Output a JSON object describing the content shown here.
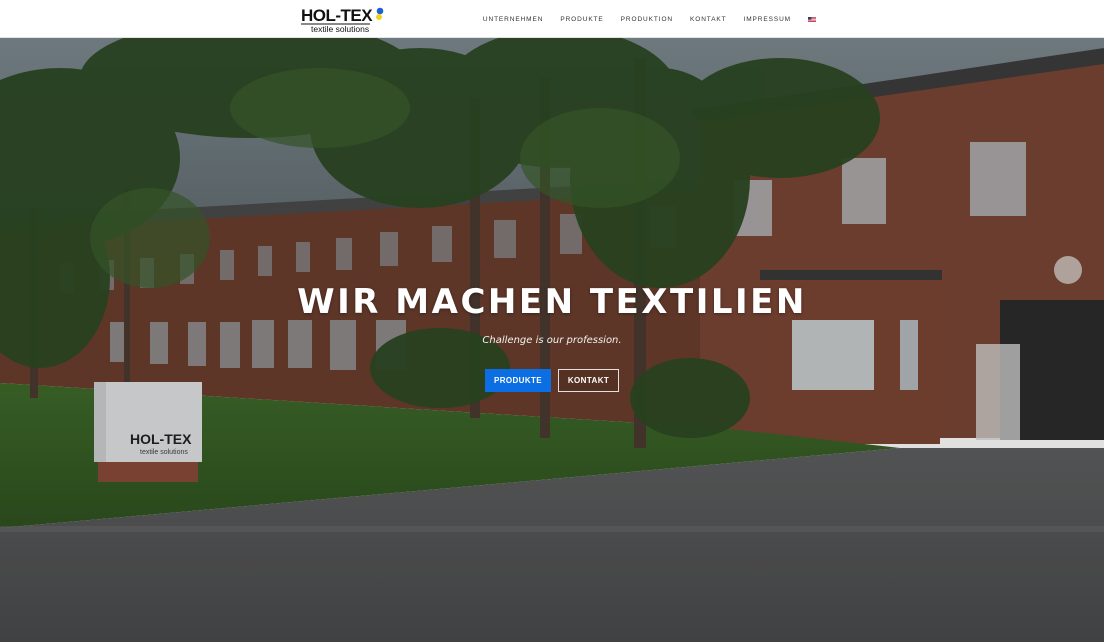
{
  "brand": {
    "logo_text": "HOL-TEX",
    "logo_subtext": "textile solutions"
  },
  "nav": {
    "items": [
      "UNTERNEHMEN",
      "PRODUKTE",
      "PRODUKTION",
      "KONTAKT",
      "IMPRESSUM"
    ],
    "language_icon": "us-flag-icon"
  },
  "hero": {
    "title": "WIR MACHEN TEXTILIEN",
    "subtitle": "Challenge is our profession.",
    "primary_button": "PRODUKTE",
    "secondary_button": "KONTAKT",
    "sign_text": "HOL-TEX",
    "sign_subtext": "textile solutions"
  },
  "colors": {
    "primary_button": "#0b6ee2",
    "header_bg": "#ffffff",
    "nav_text": "#333333"
  }
}
